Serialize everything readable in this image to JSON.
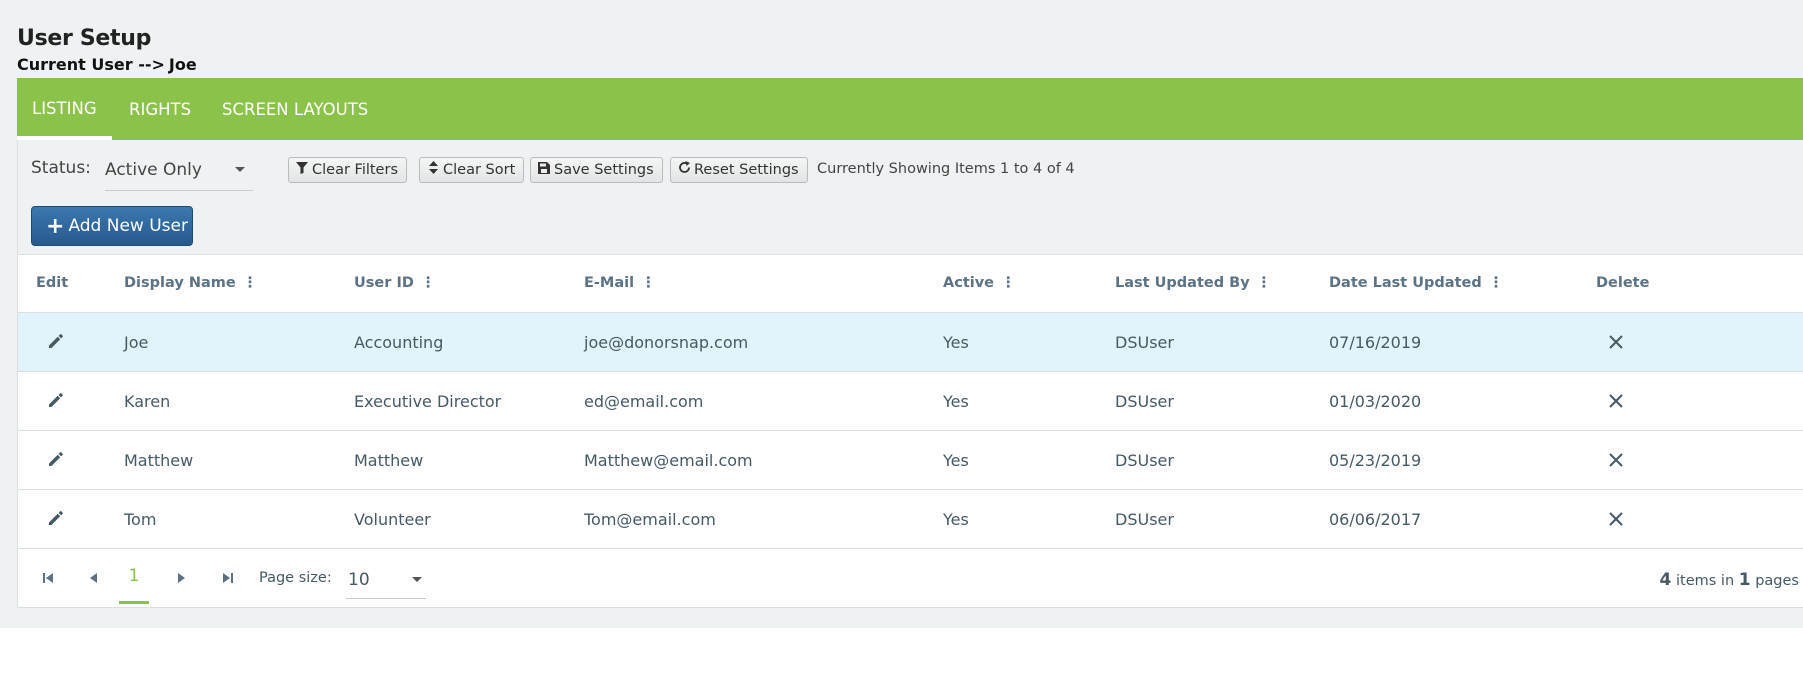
{
  "header": {
    "title": "User Setup",
    "current_user_label": "Current User -->",
    "current_user_name": "Joe"
  },
  "tabs": [
    {
      "label": "LISTING",
      "active": true
    },
    {
      "label": "RIGHTS",
      "active": false
    },
    {
      "label": "SCREEN LAYOUTS",
      "active": false
    }
  ],
  "toolbar": {
    "status_label": "Status:",
    "status_value": "Active Only",
    "clear_filters": "Clear Filters",
    "clear_sort": "Clear Sort",
    "save_settings": "Save Settings",
    "reset_settings": "Reset Settings",
    "showing_text": "Currently Showing Items 1 to 4 of 4",
    "add_new_user": "Add New User"
  },
  "grid": {
    "columns": [
      "Edit",
      "Display Name",
      "User ID",
      "E-Mail",
      "Active",
      "Last Updated By",
      "Date Last Updated",
      "Delete"
    ],
    "rows": [
      {
        "display_name": "Joe",
        "user_id": "Accounting",
        "email": "joe@donorsnap.com",
        "active": "Yes",
        "last_updated_by": "DSUser",
        "date_last_updated": "07/16/2019",
        "selected": true
      },
      {
        "display_name": "Karen",
        "user_id": "Executive Director",
        "email": "ed@email.com",
        "active": "Yes",
        "last_updated_by": "DSUser",
        "date_last_updated": "01/03/2020",
        "selected": false
      },
      {
        "display_name": "Matthew",
        "user_id": "Matthew",
        "email": "Matthew@email.com",
        "active": "Yes",
        "last_updated_by": "DSUser",
        "date_last_updated": "05/23/2019",
        "selected": false
      },
      {
        "display_name": "Tom",
        "user_id": "Volunteer",
        "email": "Tom@email.com",
        "active": "Yes",
        "last_updated_by": "DSUser",
        "date_last_updated": "06/06/2017",
        "selected": false
      }
    ]
  },
  "pager": {
    "current_page": "1",
    "page_size_label": "Page size:",
    "page_size": "10",
    "items_count": "4",
    "items_text": "items in",
    "pages_count": "1",
    "pages_text": "pages"
  },
  "colors": {
    "accent_green": "#8bc34a",
    "primary_blue": "#2b5f93",
    "selected_row": "#e3f3fb",
    "header_text": "#5b7385"
  }
}
